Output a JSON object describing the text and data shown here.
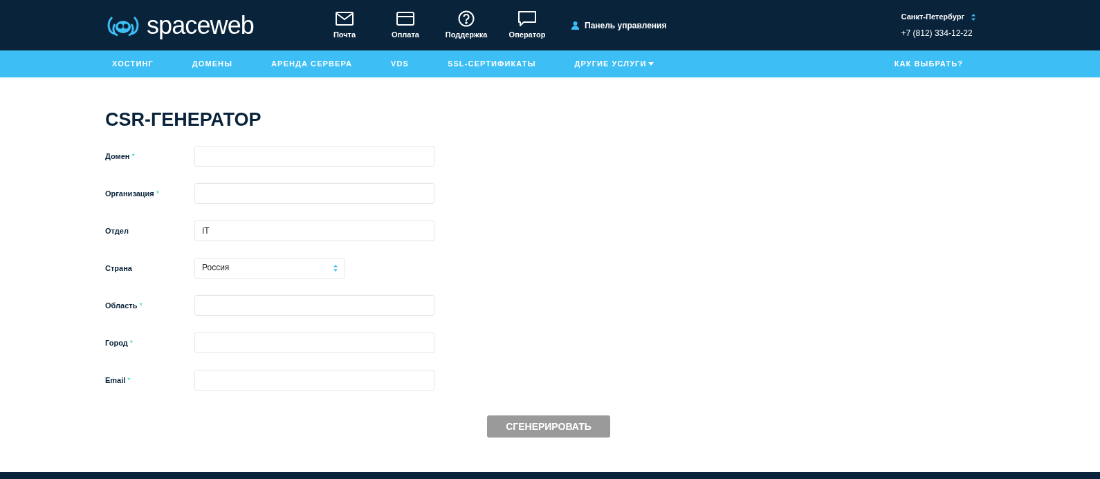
{
  "header": {
    "logo": "spaceweb",
    "shortcuts": [
      {
        "kind": "mail",
        "label": "Почта"
      },
      {
        "kind": "card",
        "label": "Оплата"
      },
      {
        "kind": "help",
        "label": "Поддержка"
      },
      {
        "kind": "chat",
        "label": "Оператор"
      }
    ],
    "account": "Панель управления",
    "city": "Санкт-Петербург",
    "phone": "+7 (812) 334-12-22"
  },
  "nav": {
    "items": [
      {
        "label": "ХОСТИНГ",
        "dropdown": false
      },
      {
        "label": "ДОМЕНЫ",
        "dropdown": false
      },
      {
        "label": "АРЕНДА СЕРВЕРА",
        "dropdown": false
      },
      {
        "label": "VDS",
        "dropdown": false
      },
      {
        "label": "SSL-СЕРТИФИКАТЫ",
        "dropdown": false
      },
      {
        "label": "ДРУГИЕ УСЛУГИ",
        "dropdown": true
      }
    ],
    "right": "КАК ВЫБРАТЬ?"
  },
  "form": {
    "title": "CSR-ГЕНЕРАТОР",
    "fields": [
      {
        "kind": "text",
        "label": "Домен",
        "mark": "*"
      },
      {
        "kind": "text",
        "label": "Организация",
        "mark": "*"
      },
      {
        "kind": "text",
        "label": "Отдел",
        "value": "IT"
      },
      {
        "kind": "select",
        "label": "Страна",
        "value": "Россия"
      },
      {
        "kind": "text",
        "label": "Область",
        "mark": "*"
      },
      {
        "kind": "text",
        "label": "Город",
        "mark": "*"
      },
      {
        "kind": "text",
        "label": "Email",
        "mark": "*"
      }
    ],
    "submit": {
      "label": "СГЕНЕРИРОВАТЬ",
      "disabled": true
    }
  }
}
